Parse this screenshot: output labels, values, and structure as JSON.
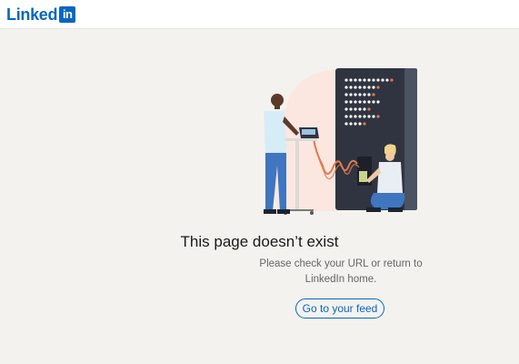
{
  "header": {
    "logo_word": "Linked",
    "logo_box": "in"
  },
  "error": {
    "title": "This page doesn’t exist",
    "message": "Please check your URL or return to LinkedIn home.",
    "button_label": "Go to your feed"
  },
  "illustration": {
    "description_icon": "server-maintenance-illustration"
  },
  "colors": {
    "brand": "#0a66c2",
    "page_background": "#f3f2ef",
    "server_dark": "#2f3440",
    "cable_orange": "#e07a4f"
  }
}
